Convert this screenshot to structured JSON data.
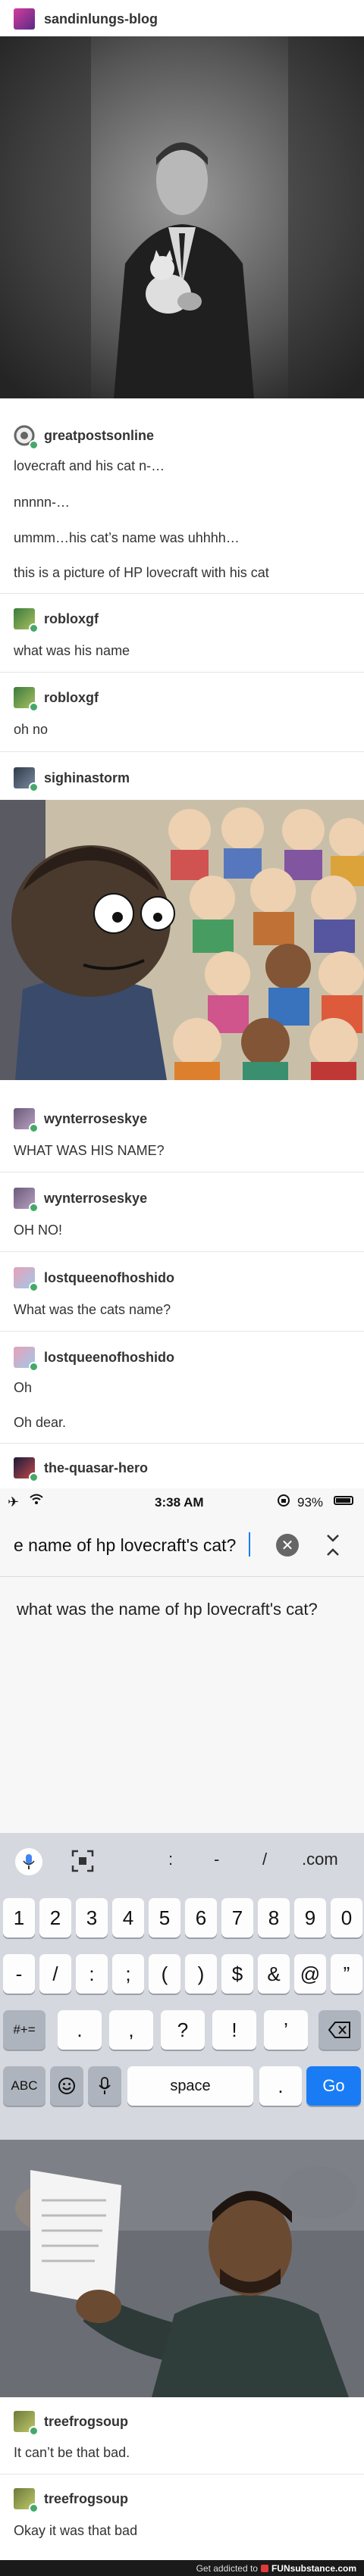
{
  "posts": {
    "first_user": "sandinlungs-blog",
    "greatposts": {
      "user": "greatpostsonline",
      "lines": [
        "lovecraft and his cat n-…",
        "nnnnn-…",
        "ummm…his cat’s name was uhhhh…",
        "this is a picture of HP lovecraft with his cat"
      ]
    },
    "roblox1": {
      "user": "robloxgf",
      "text": "what was his name"
    },
    "roblox2": {
      "user": "robloxgf",
      "text": "oh no"
    },
    "sighina": {
      "user": "sighinastorm"
    },
    "wynter1": {
      "user": "wynterroseskye",
      "text": "WHAT WAS HIS NAME?"
    },
    "wynter2": {
      "user": "wynterroseskye",
      "text": "OH NO!"
    },
    "lost1": {
      "user": "lostqueenofhoshido",
      "text": "What was the cats name?"
    },
    "lost2": {
      "user": "lostqueenofhoshido",
      "lines": [
        "Oh",
        "Oh dear."
      ]
    },
    "quasar": {
      "user": "the-quasar-hero"
    },
    "tree1": {
      "user": "treefrogsoup",
      "text": "It can’t be that bad."
    },
    "tree2": {
      "user": "treefrogsoup",
      "text": "Okay it was that bad"
    }
  },
  "phone": {
    "time": "3:38 AM",
    "battery": "93%",
    "search_value": "e name of hp lovecraft's cat?",
    "suggestion": "what was the name of hp lovecraft's cat?",
    "toolbar": [
      ":",
      "-",
      "/",
      ".com"
    ],
    "row_numbers": [
      "1",
      "2",
      "3",
      "4",
      "5",
      "6",
      "7",
      "8",
      "9",
      "0"
    ],
    "row_symbols": [
      "-",
      "/",
      ":",
      ";",
      "(",
      ")",
      "$",
      "&",
      "@",
      "”"
    ],
    "row_third": [
      "#+=",
      ".",
      ",",
      "?",
      "!",
      "’"
    ],
    "abc": "ABC",
    "space": "space",
    "period": ".",
    "go": "Go"
  },
  "footer": {
    "left": "Get addicted to",
    "brand": "FUNsubstance.com"
  },
  "colors": {
    "go_blue": "#1a7cf5",
    "badge_green": "#45a86b",
    "footer_bg": "#1a1a1a"
  }
}
